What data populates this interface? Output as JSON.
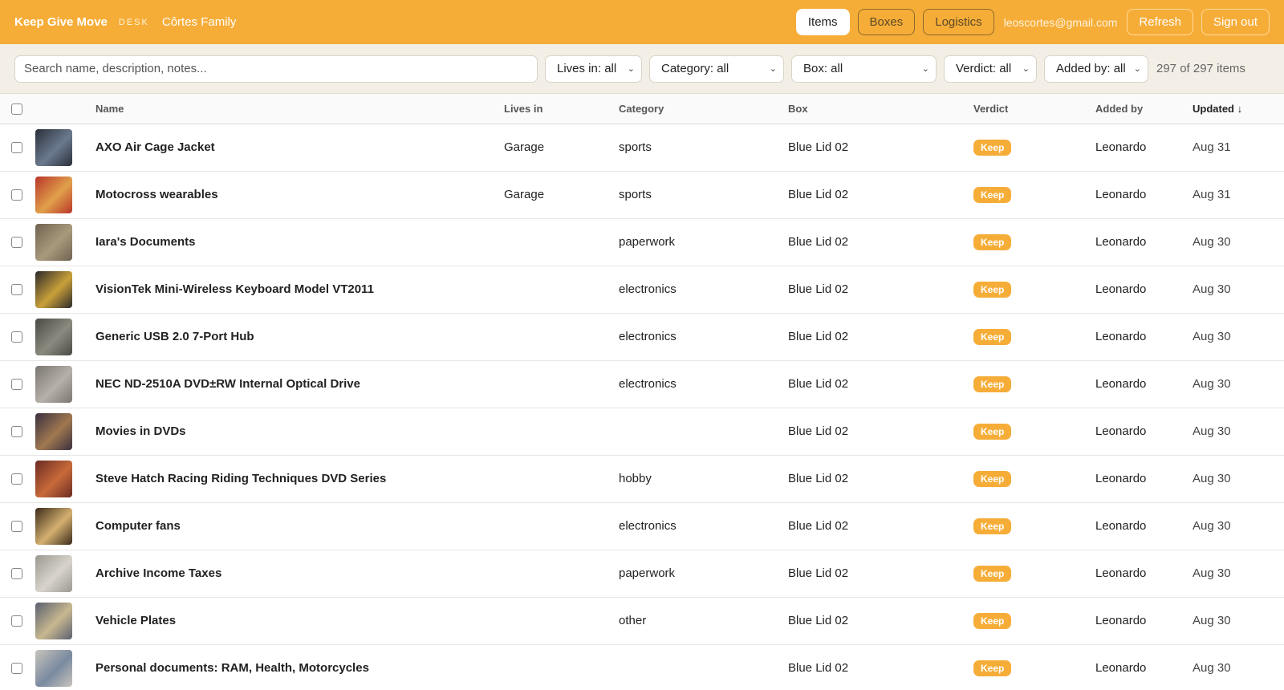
{
  "header": {
    "brand": "Keep Give Move",
    "desk": "DESK",
    "family": "Côrtes Family",
    "nav": {
      "items": "Items",
      "boxes": "Boxes",
      "logistics": "Logistics"
    },
    "email": "leoscortes@gmail.com",
    "refresh": "Refresh",
    "sign_out": "Sign out"
  },
  "filters": {
    "search_placeholder": "Search name, description, notes...",
    "lives_in": "Lives in: all",
    "category": "Category: all",
    "box": "Box: all",
    "verdict": "Verdict: all",
    "added_by": "Added by: all",
    "count": "297 of 297 items"
  },
  "table": {
    "columns": [
      "Name",
      "Lives in",
      "Category",
      "Box",
      "Verdict",
      "Added by",
      "Updated ↓"
    ],
    "rows": [
      {
        "name": "AXO Air Cage Jacket",
        "lives_in": "Garage",
        "category": "sports",
        "box": "Blue Lid 02",
        "verdict": "Keep",
        "added_by": "Leonardo",
        "updated": "Aug 31"
      },
      {
        "name": "Motocross wearables",
        "lives_in": "Garage",
        "category": "sports",
        "box": "Blue Lid 02",
        "verdict": "Keep",
        "added_by": "Leonardo",
        "updated": "Aug 31"
      },
      {
        "name": "Iara's Documents",
        "lives_in": "",
        "category": "paperwork",
        "box": "Blue Lid 02",
        "verdict": "Keep",
        "added_by": "Leonardo",
        "updated": "Aug 30"
      },
      {
        "name": "VisionTek Mini-Wireless Keyboard Model VT2011",
        "lives_in": "",
        "category": "electronics",
        "box": "Blue Lid 02",
        "verdict": "Keep",
        "added_by": "Leonardo",
        "updated": "Aug 30"
      },
      {
        "name": "Generic USB 2.0 7-Port Hub",
        "lives_in": "",
        "category": "electronics",
        "box": "Blue Lid 02",
        "verdict": "Keep",
        "added_by": "Leonardo",
        "updated": "Aug 30"
      },
      {
        "name": "NEC ND-2510A DVD±RW Internal Optical Drive",
        "lives_in": "",
        "category": "electronics",
        "box": "Blue Lid 02",
        "verdict": "Keep",
        "added_by": "Leonardo",
        "updated": "Aug 30"
      },
      {
        "name": "Movies in DVDs",
        "lives_in": "",
        "category": "",
        "box": "Blue Lid 02",
        "verdict": "Keep",
        "added_by": "Leonardo",
        "updated": "Aug 30"
      },
      {
        "name": "Steve Hatch Racing Riding Techniques DVD Series",
        "lives_in": "",
        "category": "hobby",
        "box": "Blue Lid 02",
        "verdict": "Keep",
        "added_by": "Leonardo",
        "updated": "Aug 30"
      },
      {
        "name": "Computer fans",
        "lives_in": "",
        "category": "electronics",
        "box": "Blue Lid 02",
        "verdict": "Keep",
        "added_by": "Leonardo",
        "updated": "Aug 30"
      },
      {
        "name": "Archive Income Taxes",
        "lives_in": "",
        "category": "paperwork",
        "box": "Blue Lid 02",
        "verdict": "Keep",
        "added_by": "Leonardo",
        "updated": "Aug 30"
      },
      {
        "name": "Vehicle Plates",
        "lives_in": "",
        "category": "other",
        "box": "Blue Lid 02",
        "verdict": "Keep",
        "added_by": "Leonardo",
        "updated": "Aug 30"
      },
      {
        "name": "Personal documents: RAM, Health, Motorcycles",
        "lives_in": "",
        "category": "",
        "box": "Blue Lid 02",
        "verdict": "Keep",
        "added_by": "Leonardo",
        "updated": "Aug 30"
      }
    ]
  },
  "colors": {
    "accent": "#f6ad38",
    "filter_bg": "#f3efe6"
  },
  "icons": {
    "chevron": "chevron-down-icon",
    "checkbox": "checkbox-icon"
  }
}
